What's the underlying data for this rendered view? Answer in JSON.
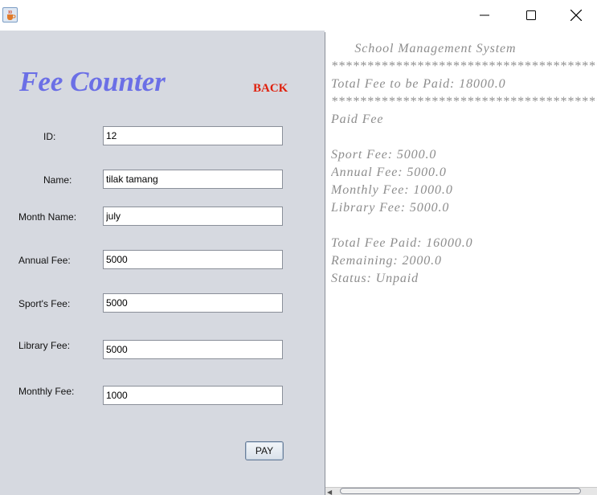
{
  "header": {
    "app_icon": "java-cup-icon",
    "controls": [
      "minimize-icon",
      "maximize-icon",
      "close-icon"
    ]
  },
  "form": {
    "title": "Fee Counter",
    "back_label": "BACK",
    "fields": {
      "id": {
        "label": "ID:",
        "value": "12"
      },
      "name": {
        "label": "Name:",
        "value": "tilak tamang"
      },
      "month": {
        "label": "Month Name:",
        "value": "july"
      },
      "annual": {
        "label": "Annual Fee:",
        "value": "5000"
      },
      "sport": {
        "label": "Sport's Fee:",
        "value": "5000"
      },
      "library": {
        "label": "Library Fee:",
        "value": "5000"
      },
      "monthly": {
        "label": "Monthly Fee:",
        "value": "1000"
      }
    },
    "pay_label": "PAY"
  },
  "receipt": {
    "lines": [
      "      School Management System",
      "*************************************************",
      "Total Fee to be Paid: 18000.0",
      "*************************************************",
      "Paid Fee",
      "",
      "Sport Fee: 5000.0",
      "Annual Fee: 5000.0",
      "Monthly Fee: 1000.0",
      "Library Fee: 5000.0",
      "",
      "Total Fee Paid: 16000.0",
      "Remaining: 2000.0",
      "Status: Unpaid"
    ]
  },
  "colors": {
    "title": "#6b6fe6",
    "back": "#e0200c",
    "panel": "#d6d9e0",
    "receipt_text": "#8d8d8d"
  }
}
